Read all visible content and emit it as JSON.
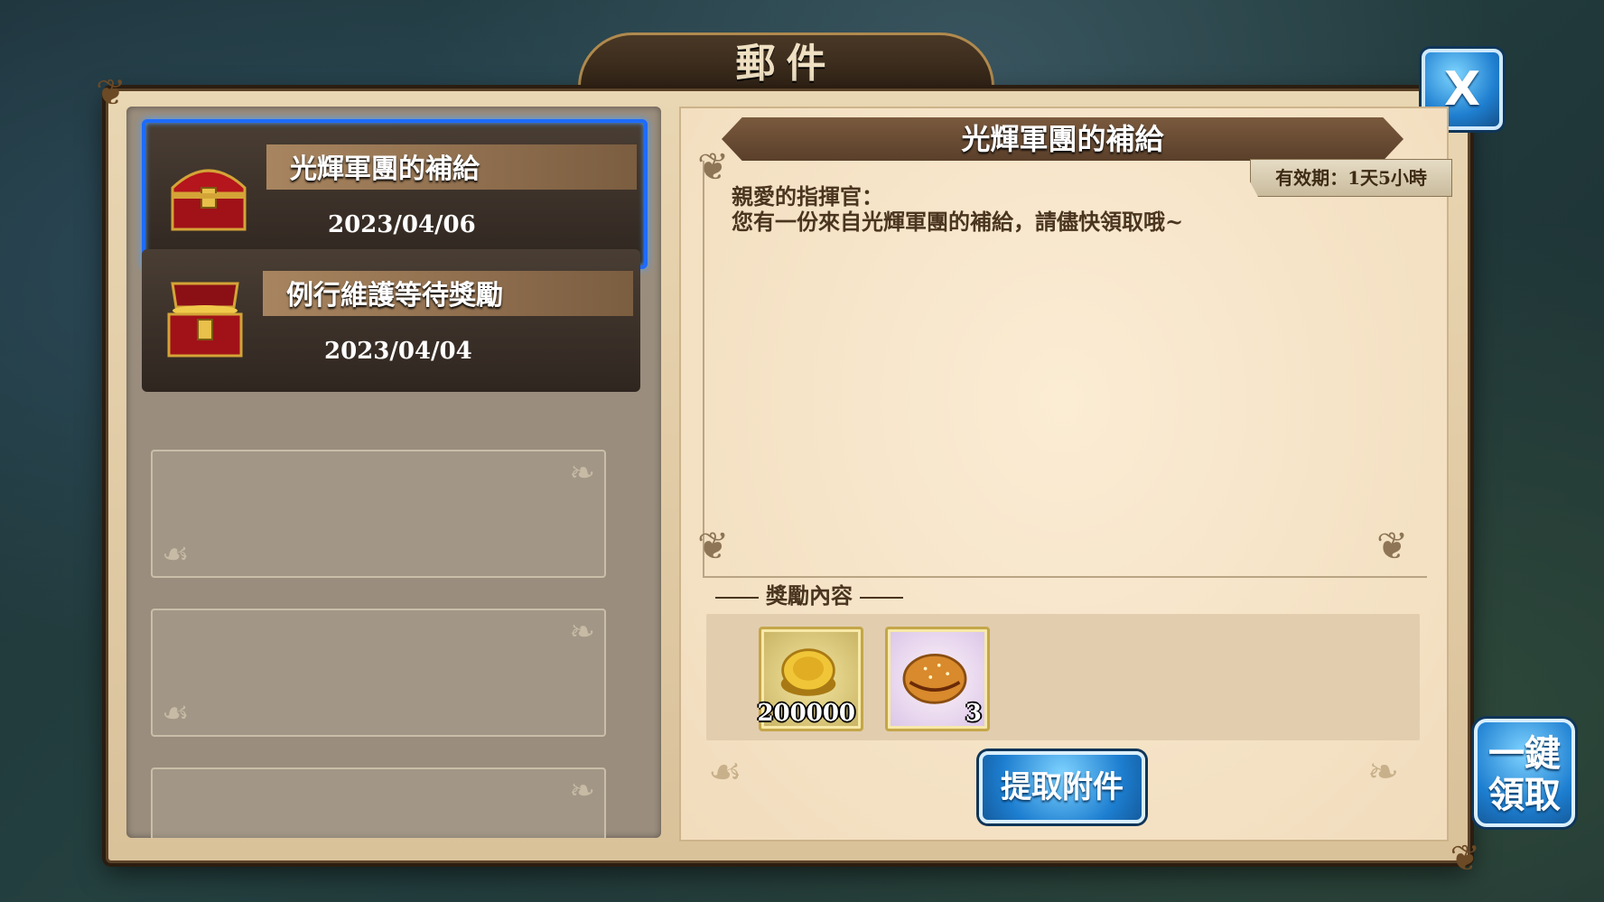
{
  "window": {
    "title": "郵件",
    "close_label": "X"
  },
  "mail_list": [
    {
      "subject": "光輝軍團的補給",
      "date": "2023/04/06",
      "selected": true,
      "icon": "closed-treasure-chest-icon"
    },
    {
      "subject": "例行維護等待獎勵",
      "date": "2023/04/04",
      "selected": false,
      "icon": "open-treasure-chest-icon"
    }
  ],
  "detail": {
    "title": "光輝軍團的補給",
    "validity": "有效期：1天5小時",
    "greeting": "親愛的指揮官：",
    "message": "您有一份來自光輝軍團的補給，請儘快領取哦~",
    "reward_label": "獎勵內容",
    "rewards": [
      {
        "icon": "gold-coin-icon",
        "quantity": "200000"
      },
      {
        "icon": "bread-bun-icon",
        "quantity": "3"
      }
    ],
    "claim_label": "提取附件"
  },
  "claim_all": {
    "line1": "一鍵",
    "line2": "領取"
  },
  "colors": {
    "accent_blue": "#1d7ed0",
    "selected_border": "#1e6bff",
    "parchment": "#f1dcbc"
  }
}
